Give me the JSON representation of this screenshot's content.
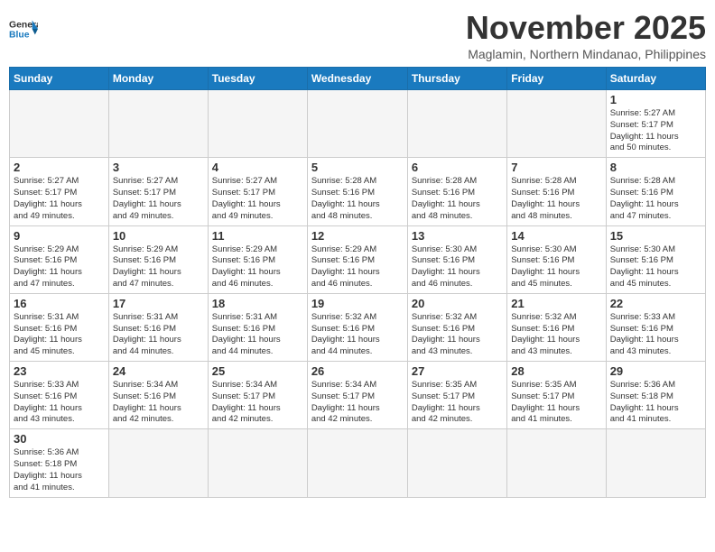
{
  "header": {
    "logo_general": "General",
    "logo_blue": "Blue",
    "month_title": "November 2025",
    "location": "Maglamin, Northern Mindanao, Philippines"
  },
  "days_of_week": [
    "Sunday",
    "Monday",
    "Tuesday",
    "Wednesday",
    "Thursday",
    "Friday",
    "Saturday"
  ],
  "weeks": [
    [
      {
        "day": null,
        "info": null
      },
      {
        "day": null,
        "info": null
      },
      {
        "day": null,
        "info": null
      },
      {
        "day": null,
        "info": null
      },
      {
        "day": null,
        "info": null
      },
      {
        "day": null,
        "info": null
      },
      {
        "day": "1",
        "info": "Sunrise: 5:27 AM\nSunset: 5:17 PM\nDaylight: 11 hours\nand 50 minutes."
      }
    ],
    [
      {
        "day": "2",
        "info": "Sunrise: 5:27 AM\nSunset: 5:17 PM\nDaylight: 11 hours\nand 49 minutes."
      },
      {
        "day": "3",
        "info": "Sunrise: 5:27 AM\nSunset: 5:17 PM\nDaylight: 11 hours\nand 49 minutes."
      },
      {
        "day": "4",
        "info": "Sunrise: 5:27 AM\nSunset: 5:17 PM\nDaylight: 11 hours\nand 49 minutes."
      },
      {
        "day": "5",
        "info": "Sunrise: 5:28 AM\nSunset: 5:16 PM\nDaylight: 11 hours\nand 48 minutes."
      },
      {
        "day": "6",
        "info": "Sunrise: 5:28 AM\nSunset: 5:16 PM\nDaylight: 11 hours\nand 48 minutes."
      },
      {
        "day": "7",
        "info": "Sunrise: 5:28 AM\nSunset: 5:16 PM\nDaylight: 11 hours\nand 48 minutes."
      },
      {
        "day": "8",
        "info": "Sunrise: 5:28 AM\nSunset: 5:16 PM\nDaylight: 11 hours\nand 47 minutes."
      }
    ],
    [
      {
        "day": "9",
        "info": "Sunrise: 5:29 AM\nSunset: 5:16 PM\nDaylight: 11 hours\nand 47 minutes."
      },
      {
        "day": "10",
        "info": "Sunrise: 5:29 AM\nSunset: 5:16 PM\nDaylight: 11 hours\nand 47 minutes."
      },
      {
        "day": "11",
        "info": "Sunrise: 5:29 AM\nSunset: 5:16 PM\nDaylight: 11 hours\nand 46 minutes."
      },
      {
        "day": "12",
        "info": "Sunrise: 5:29 AM\nSunset: 5:16 PM\nDaylight: 11 hours\nand 46 minutes."
      },
      {
        "day": "13",
        "info": "Sunrise: 5:30 AM\nSunset: 5:16 PM\nDaylight: 11 hours\nand 46 minutes."
      },
      {
        "day": "14",
        "info": "Sunrise: 5:30 AM\nSunset: 5:16 PM\nDaylight: 11 hours\nand 45 minutes."
      },
      {
        "day": "15",
        "info": "Sunrise: 5:30 AM\nSunset: 5:16 PM\nDaylight: 11 hours\nand 45 minutes."
      }
    ],
    [
      {
        "day": "16",
        "info": "Sunrise: 5:31 AM\nSunset: 5:16 PM\nDaylight: 11 hours\nand 45 minutes."
      },
      {
        "day": "17",
        "info": "Sunrise: 5:31 AM\nSunset: 5:16 PM\nDaylight: 11 hours\nand 44 minutes."
      },
      {
        "day": "18",
        "info": "Sunrise: 5:31 AM\nSunset: 5:16 PM\nDaylight: 11 hours\nand 44 minutes."
      },
      {
        "day": "19",
        "info": "Sunrise: 5:32 AM\nSunset: 5:16 PM\nDaylight: 11 hours\nand 44 minutes."
      },
      {
        "day": "20",
        "info": "Sunrise: 5:32 AM\nSunset: 5:16 PM\nDaylight: 11 hours\nand 43 minutes."
      },
      {
        "day": "21",
        "info": "Sunrise: 5:32 AM\nSunset: 5:16 PM\nDaylight: 11 hours\nand 43 minutes."
      },
      {
        "day": "22",
        "info": "Sunrise: 5:33 AM\nSunset: 5:16 PM\nDaylight: 11 hours\nand 43 minutes."
      }
    ],
    [
      {
        "day": "23",
        "info": "Sunrise: 5:33 AM\nSunset: 5:16 PM\nDaylight: 11 hours\nand 43 minutes."
      },
      {
        "day": "24",
        "info": "Sunrise: 5:34 AM\nSunset: 5:16 PM\nDaylight: 11 hours\nand 42 minutes."
      },
      {
        "day": "25",
        "info": "Sunrise: 5:34 AM\nSunset: 5:17 PM\nDaylight: 11 hours\nand 42 minutes."
      },
      {
        "day": "26",
        "info": "Sunrise: 5:34 AM\nSunset: 5:17 PM\nDaylight: 11 hours\nand 42 minutes."
      },
      {
        "day": "27",
        "info": "Sunrise: 5:35 AM\nSunset: 5:17 PM\nDaylight: 11 hours\nand 42 minutes."
      },
      {
        "day": "28",
        "info": "Sunrise: 5:35 AM\nSunset: 5:17 PM\nDaylight: 11 hours\nand 41 minutes."
      },
      {
        "day": "29",
        "info": "Sunrise: 5:36 AM\nSunset: 5:18 PM\nDaylight: 11 hours\nand 41 minutes."
      }
    ],
    [
      {
        "day": "30",
        "info": "Sunrise: 5:36 AM\nSunset: 5:18 PM\nDaylight: 11 hours\nand 41 minutes."
      },
      {
        "day": null,
        "info": null
      },
      {
        "day": null,
        "info": null
      },
      {
        "day": null,
        "info": null
      },
      {
        "day": null,
        "info": null
      },
      {
        "day": null,
        "info": null
      },
      {
        "day": null,
        "info": null
      }
    ]
  ]
}
